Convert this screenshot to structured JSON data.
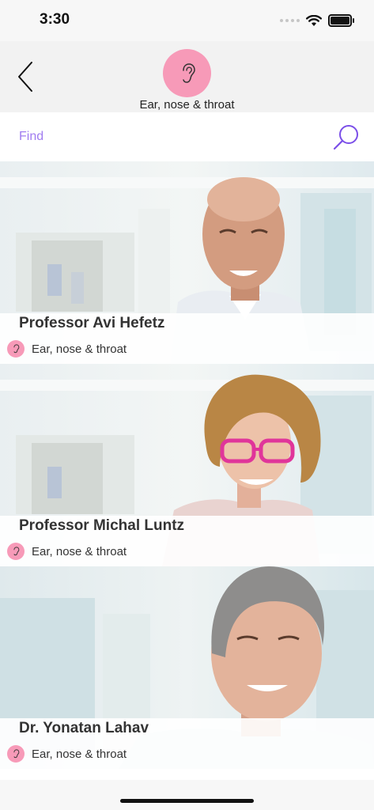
{
  "status_bar": {
    "time": "3:30"
  },
  "header": {
    "category_label": "Ear, nose & throat",
    "category_icon": "ear-icon",
    "accent_color": "#f79ab8"
  },
  "search": {
    "placeholder": "Find",
    "value": "",
    "icon": "search-icon",
    "icon_color": "#7b4fe8"
  },
  "doctors": [
    {
      "name": "Professor Avi Hefetz",
      "specialty": "Ear, nose & throat"
    },
    {
      "name": "Professor Michal Luntz",
      "specialty": "Ear, nose & throat"
    },
    {
      "name": "Dr. Yonatan Lahav",
      "specialty": "Ear, nose & throat"
    }
  ]
}
